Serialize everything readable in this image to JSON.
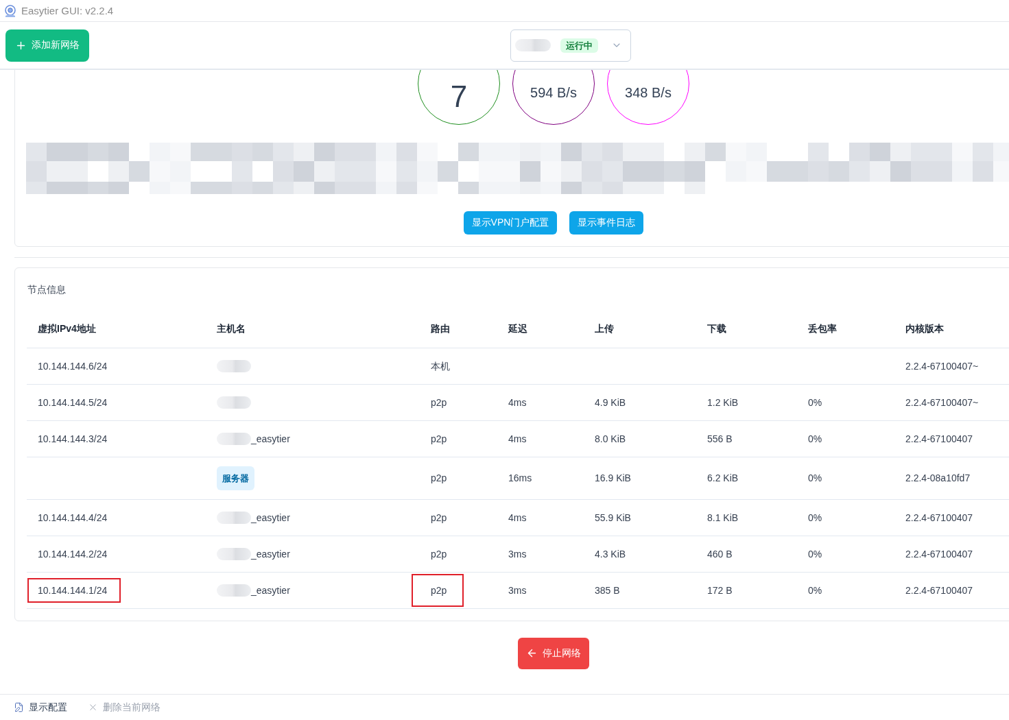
{
  "window": {
    "title": "Easytier GUI: v2.2.4"
  },
  "toolbar": {
    "add_button": "添加新网络",
    "network_select": {
      "name_blurred": true,
      "status": "运行中"
    }
  },
  "overview": {
    "stats": [
      {
        "kind": "count",
        "value": "7",
        "color": "#1f8f1f"
      },
      {
        "kind": "rate",
        "value": "594 B/s",
        "color": "#800080"
      },
      {
        "kind": "rate",
        "value": "348 B/s",
        "color": "#ff00ff"
      }
    ],
    "details_pixelated": true,
    "buttons": [
      "显示VPN门户配置",
      "显示事件日志"
    ]
  },
  "peers": {
    "title": "节点信息",
    "columns": [
      "虚拟IPv4地址",
      "主机名",
      "路由",
      "延迟",
      "上传",
      "下载",
      "丢包率",
      "内核版本"
    ],
    "rows": [
      {
        "ip": "10.144.144.6/24",
        "host_blurred": true,
        "route": "本机",
        "version": "2.2.4-67100407~",
        "ip_marked": false,
        "route_marked": false
      },
      {
        "ip": "10.144.144.5/24",
        "host_blurred": true,
        "route": "p2p",
        "latency": "4ms",
        "upload": "4.9 KiB",
        "download": "1.2 KiB",
        "loss": "0%",
        "version": "2.2.4-67100407~",
        "ip_marked": false,
        "route_marked": false
      },
      {
        "ip": "10.144.144.3/24",
        "host_blurred": true,
        "host": "_easytier",
        "route": "p2p",
        "latency": "4ms",
        "upload": "8.0 KiB",
        "download": "556 B",
        "loss": "0%",
        "version": "2.2.4-67100407",
        "ip_marked": false,
        "route_marked": false
      },
      {
        "host_blurred": false,
        "host_tag": "服务器",
        "route": "p2p",
        "latency": "16ms",
        "upload": "16.9 KiB",
        "download": "6.2 KiB",
        "loss": "0%",
        "version": "2.2.4-08a10fd7",
        "ip_marked": false,
        "route_marked": false
      },
      {
        "ip": "10.144.144.4/24",
        "host_blurred": true,
        "host": "_easytier",
        "route": "p2p",
        "latency": "4ms",
        "upload": "55.9 KiB",
        "download": "8.1 KiB",
        "loss": "0%",
        "version": "2.2.4-67100407",
        "ip_marked": false,
        "route_marked": false
      },
      {
        "ip": "10.144.144.2/24",
        "host_blurred": true,
        "host": "_easytier",
        "route": "p2p",
        "latency": "3ms",
        "upload": "4.3 KiB",
        "download": "460 B",
        "loss": "0%",
        "version": "2.2.4-67100407",
        "ip_marked": false,
        "route_marked": false
      },
      {
        "ip": "10.144.144.1/24",
        "host_blurred": true,
        "host": "_easytier",
        "route": "p2p",
        "latency": "3ms",
        "upload": "385 B",
        "download": "172 B",
        "loss": "0%",
        "version": "2.2.4-67100407",
        "ip_marked": true,
        "route_marked": true
      }
    ]
  },
  "stop_button": "停止网络",
  "footer": {
    "actions": [
      {
        "kind": "edit",
        "label": "显示配置",
        "disabled": false
      },
      {
        "kind": "delete",
        "label": "删除当前网络",
        "disabled": true
      }
    ]
  }
}
